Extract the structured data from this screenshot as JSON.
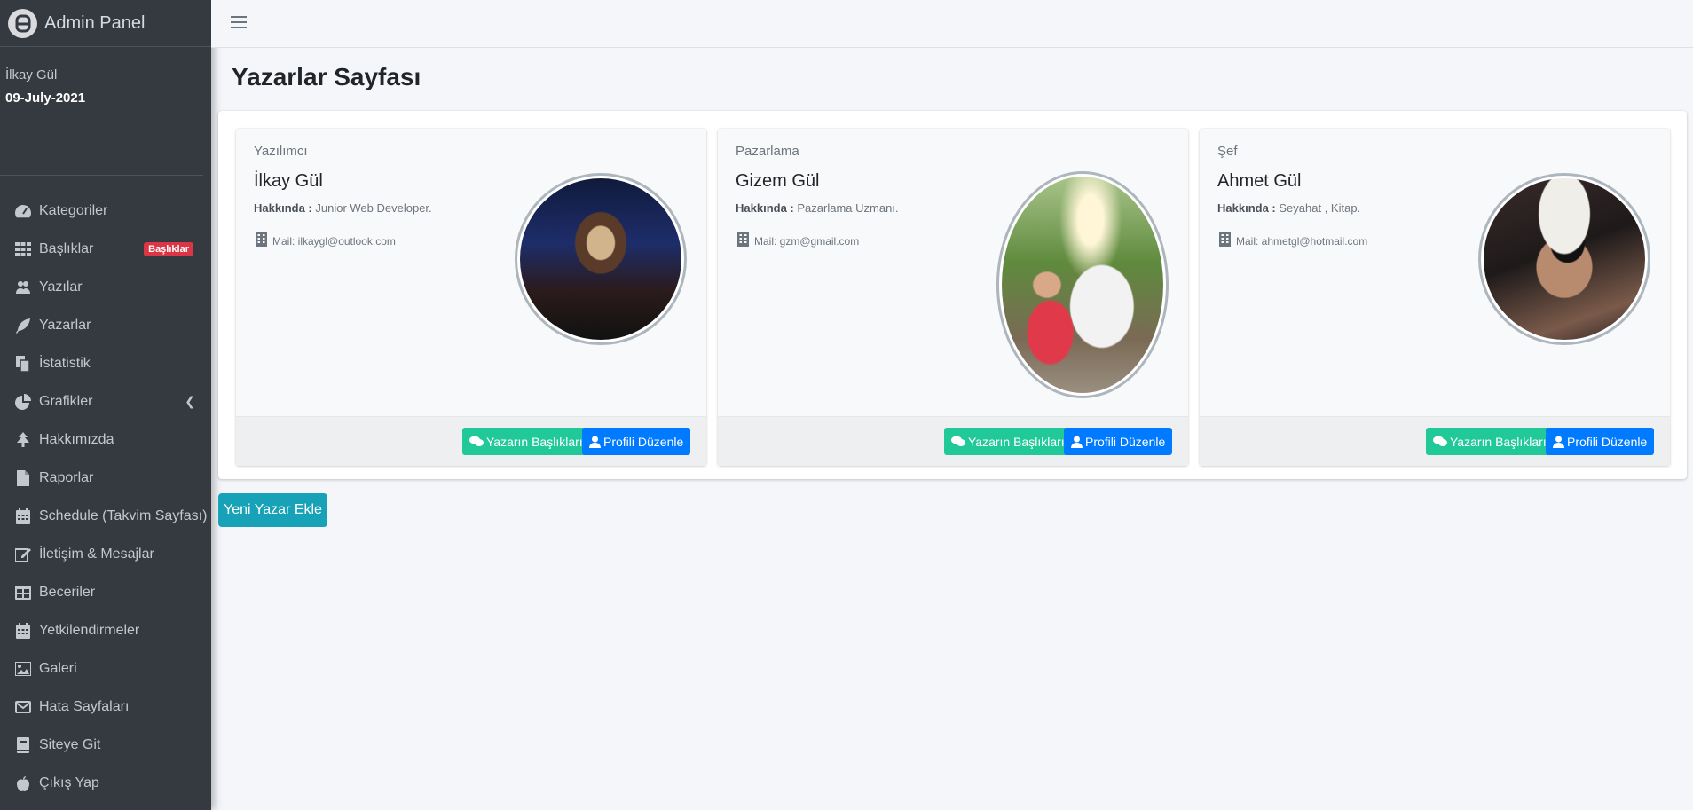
{
  "brand": {
    "title": "Admin Panel"
  },
  "user": {
    "name": "İlkay Gül",
    "date": "09-July-2021"
  },
  "sidebar": {
    "items": [
      {
        "label": "Kategoriler",
        "icon": "tachometer-icon"
      },
      {
        "label": "Başlıklar",
        "icon": "grid-icon",
        "badge": "Başlıklar"
      },
      {
        "label": "Yazılar",
        "icon": "users-icon"
      },
      {
        "label": "Yazarlar",
        "icon": "feather-icon"
      },
      {
        "label": "İstatistik",
        "icon": "copy-icon"
      },
      {
        "label": "Grafikler",
        "icon": "pie-chart-icon"
      },
      {
        "label": "Hakkımızda",
        "icon": "tree-icon"
      },
      {
        "label": "Raporlar",
        "icon": "file-icon"
      },
      {
        "label": "Schedule (Takvim Sayfası)",
        "icon": "calendar-icon"
      },
      {
        "label": "İletişim & Mesajlar",
        "icon": "edit-icon"
      },
      {
        "label": "Beceriler",
        "icon": "table-icon"
      },
      {
        "label": "Yetkilendirmeler",
        "icon": "calendar-icon"
      },
      {
        "label": "Galeri",
        "icon": "image-icon"
      },
      {
        "label": "Hata Sayfaları",
        "icon": "envelope-icon"
      },
      {
        "label": "Siteye Git",
        "icon": "book-icon"
      },
      {
        "label": "Çıkış Yap",
        "icon": "apple-icon"
      }
    ]
  },
  "page": {
    "title": "Yazarlar Sayfası",
    "add_button": "Yeni Yazar Ekle"
  },
  "authors": [
    {
      "role": "Yazılımcı",
      "name": "İlkay Gül",
      "about_label": "Hakkında :",
      "about": "Junior Web Developer.",
      "mail": "Mail: ilkaygl@outlook.com",
      "btn_titles": "Yazarın Başlıkları",
      "btn_profile": "Profili Düzenle"
    },
    {
      "role": "Pazarlama",
      "name": "Gizem Gül",
      "about_label": "Hakkında :",
      "about": "Pazarlama Uzmanı.",
      "mail": "Mail: gzm@gmail.com",
      "btn_titles": "Yazarın Başlıkları",
      "btn_profile": "Profili Düzenle"
    },
    {
      "role": "Şef",
      "name": "Ahmet Gül",
      "about_label": "Hakkında :",
      "about": "Seyahat , Kitap.",
      "mail": "Mail: ahmetgl@hotmail.com",
      "btn_titles": "Yazarın Başlıkları",
      "btn_profile": "Profili Düzenle"
    }
  ]
}
